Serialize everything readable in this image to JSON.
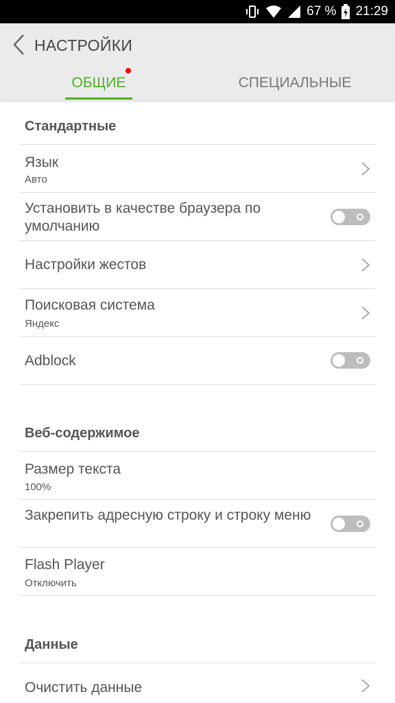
{
  "status_bar": {
    "battery": "67 %",
    "time": "21:29"
  },
  "header": {
    "title": "НАСТРОЙКИ"
  },
  "tabs": [
    {
      "label": "ОБЩИЕ",
      "active": true,
      "has_notification": true
    },
    {
      "label": "СПЕЦИАЛЬНЫЕ",
      "active": false
    }
  ],
  "sections": {
    "standard": {
      "title": "Стандартные",
      "items": [
        {
          "title": "Язык",
          "subtitle": "Авто",
          "control": "chevron"
        },
        {
          "title": "Установить в качестве браузера по умолчанию",
          "control": "toggle",
          "enabled": false
        },
        {
          "title": "Настройки жестов",
          "control": "chevron"
        },
        {
          "title": "Поисковая система",
          "subtitle": "Яндекс",
          "control": "chevron"
        },
        {
          "title": "Adblock",
          "control": "toggle",
          "enabled": false
        }
      ]
    },
    "web": {
      "title": "Веб-содержимое",
      "items": [
        {
          "title": "Размер текста",
          "subtitle": "100%",
          "control": "none"
        },
        {
          "title": "Закрепить адресную строку и строку меню",
          "control": "toggle",
          "enabled": false
        },
        {
          "title": "Flash Player",
          "subtitle": "Отключить",
          "control": "none"
        }
      ]
    },
    "data": {
      "title": "Данные",
      "items": [
        {
          "title": "Очистить данные",
          "control": "chevron"
        }
      ]
    }
  },
  "colors": {
    "accent": "#4caf23",
    "notification": "#ff0000",
    "toggle_off": "#bdbdbd"
  }
}
